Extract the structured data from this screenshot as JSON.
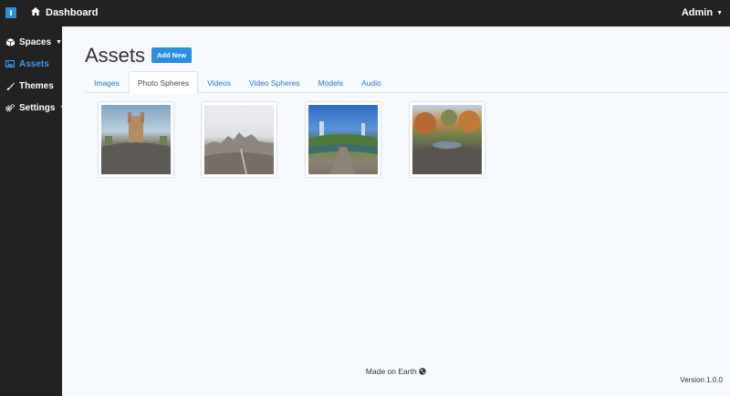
{
  "topbar": {
    "brand_label": "Dashboard",
    "brand_icon": "home-icon",
    "user_label": "Admin",
    "accent": "#2a8fde",
    "bg": "#222222"
  },
  "sidebar": {
    "items": [
      {
        "label": "Spaces",
        "icon": "cube-icon",
        "has_caret": true,
        "active": false
      },
      {
        "label": "Assets",
        "icon": "image-icon",
        "has_caret": false,
        "active": true
      },
      {
        "label": "Themes",
        "icon": "brush-icon",
        "has_caret": false,
        "active": false
      },
      {
        "label": "Settings",
        "icon": "gears-icon",
        "has_caret": true,
        "active": false
      }
    ],
    "active_color": "#3a9cf0"
  },
  "main": {
    "title": "Assets",
    "add_button_label": "Add New",
    "tabs": [
      {
        "label": "Images",
        "active": false
      },
      {
        "label": "Photo Spheres",
        "active": true
      },
      {
        "label": "Videos",
        "active": false
      },
      {
        "label": "Video Spheres",
        "active": false
      },
      {
        "label": "Models",
        "active": false
      },
      {
        "label": "Audio",
        "active": false
      }
    ],
    "thumbnails": 4
  },
  "footer": {
    "made_on": "Made on Earth",
    "version": "Version 1.0.0"
  }
}
